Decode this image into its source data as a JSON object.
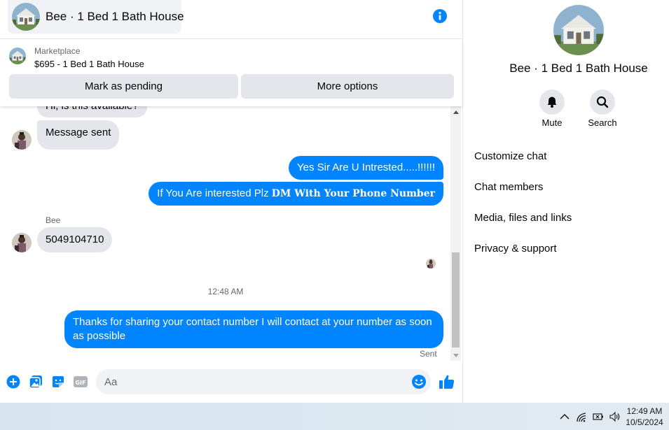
{
  "header": {
    "title": "Bee · 1 Bed 1 Bath House"
  },
  "marketplace": {
    "label": "Marketplace",
    "item": "$695 - 1 Bed 1 Bath House",
    "mark_pending": "Mark as pending",
    "more_options": "More options"
  },
  "messages": {
    "partial_top": "Hi, is this available?",
    "msg_sent": "Message sent",
    "out1": "Yes Sir Are U Intrested.....!!!!!!",
    "out2_plain": "If You Are interested Plz ",
    "out2_bold": "DM With Your Phone Number",
    "sender": "Bee",
    "in_phone": "5049104710",
    "timestamp": "12:48 AM",
    "out3": "Thanks for sharing your contact number I will contact at your number as soon as possible",
    "sent_label": "Sent"
  },
  "composer": {
    "placeholder": "Aa",
    "icons": [
      "plus-icon",
      "photo-icon",
      "sticker-icon",
      "gif-icon",
      "emoji-icon",
      "like-icon"
    ]
  },
  "info_panel": {
    "name": "Bee · 1 Bed 1 Bath House",
    "mute_label": "Mute",
    "search_label": "Search",
    "menu": [
      "Customize chat",
      "Chat members",
      "Media, files and links",
      "Privacy & support"
    ]
  },
  "taskbar": {
    "time": "12:49 AM",
    "date": "10/5/2024"
  },
  "colors": {
    "accent": "#0084ff",
    "incoming_bubble": "#e4e6eb",
    "secondary_text": "#65676b"
  }
}
